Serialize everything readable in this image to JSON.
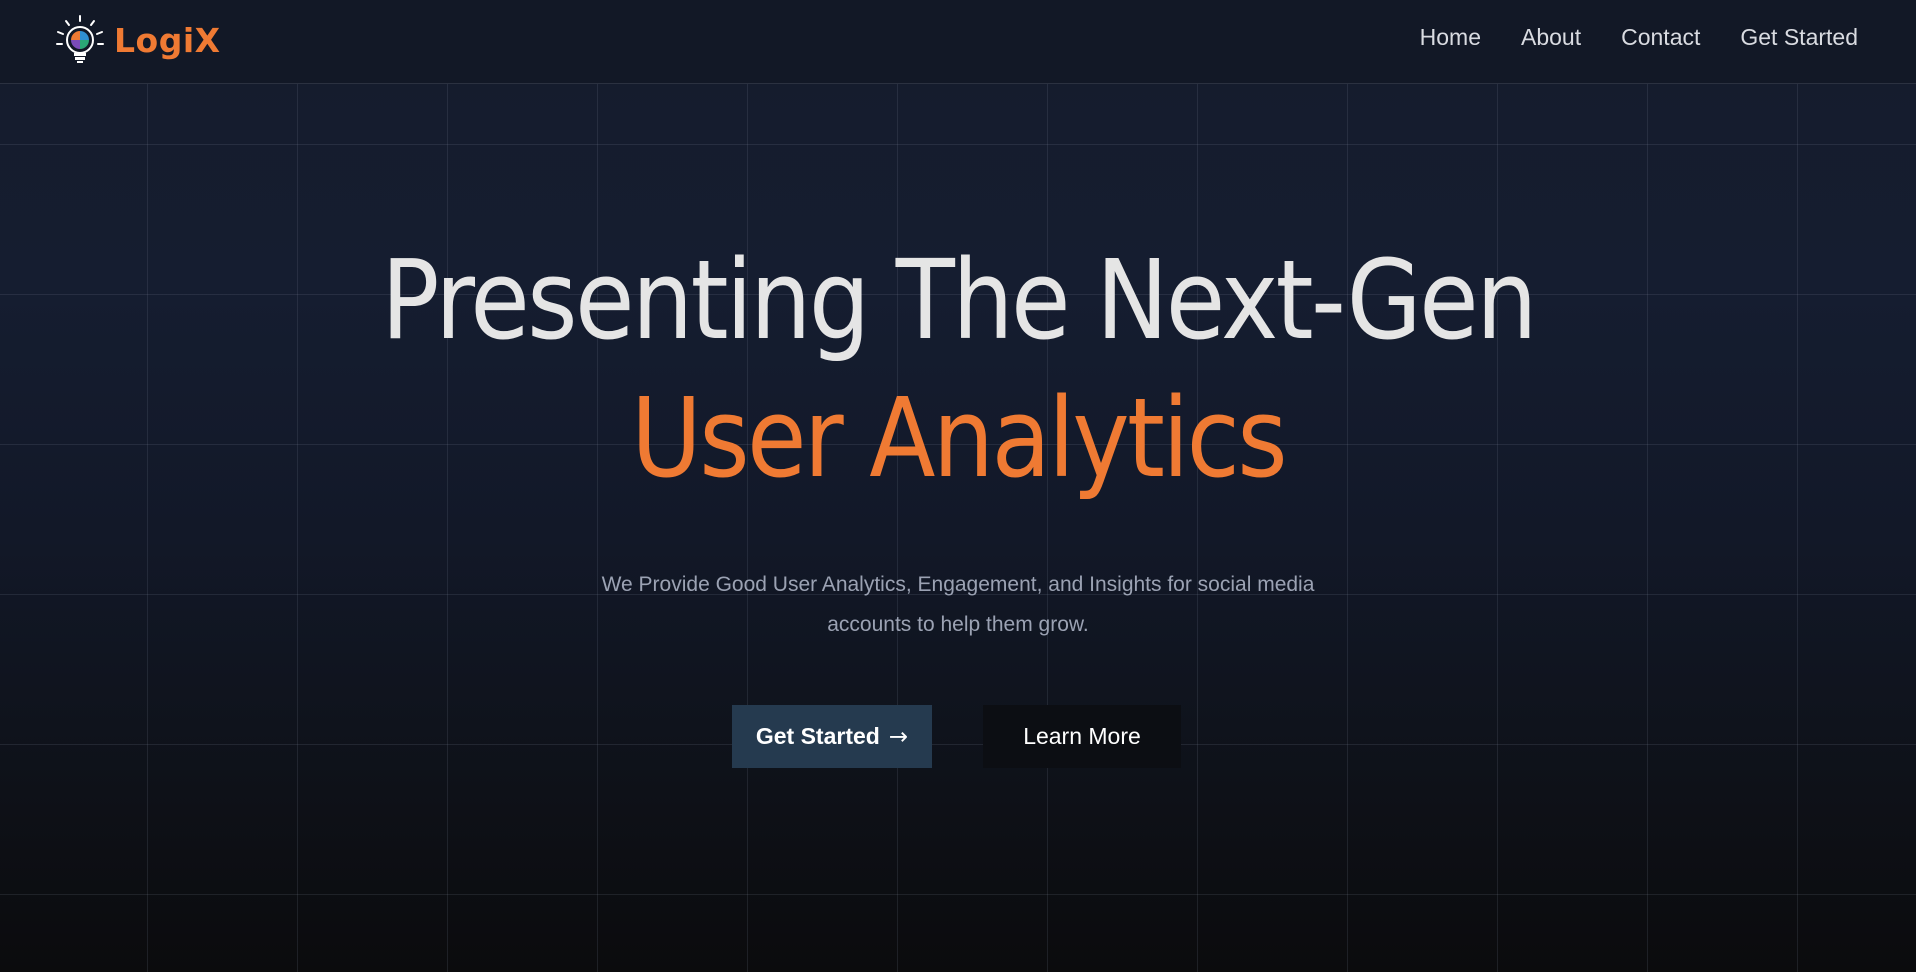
{
  "brand": {
    "name": "LogiX",
    "accent_color": "#ef7a33",
    "logo_icon": "lightbulb-puzzle-icon"
  },
  "nav": {
    "items": [
      {
        "label": "Home"
      },
      {
        "label": "About"
      },
      {
        "label": "Contact"
      },
      {
        "label": "Get Started"
      }
    ]
  },
  "hero": {
    "title_line1": "Presenting The Next-Gen",
    "title_line2": "User Analytics",
    "subtitle": "We Provide Good User Analytics, Engagement, and Insights for social media accounts to help them grow.",
    "primary_button": {
      "label": "Get Started",
      "icon": "arrow-right-icon",
      "icon_glyph": "→",
      "color": "#253a4f"
    },
    "secondary_button": {
      "label": "Learn More",
      "color": "#0c0e13"
    }
  }
}
